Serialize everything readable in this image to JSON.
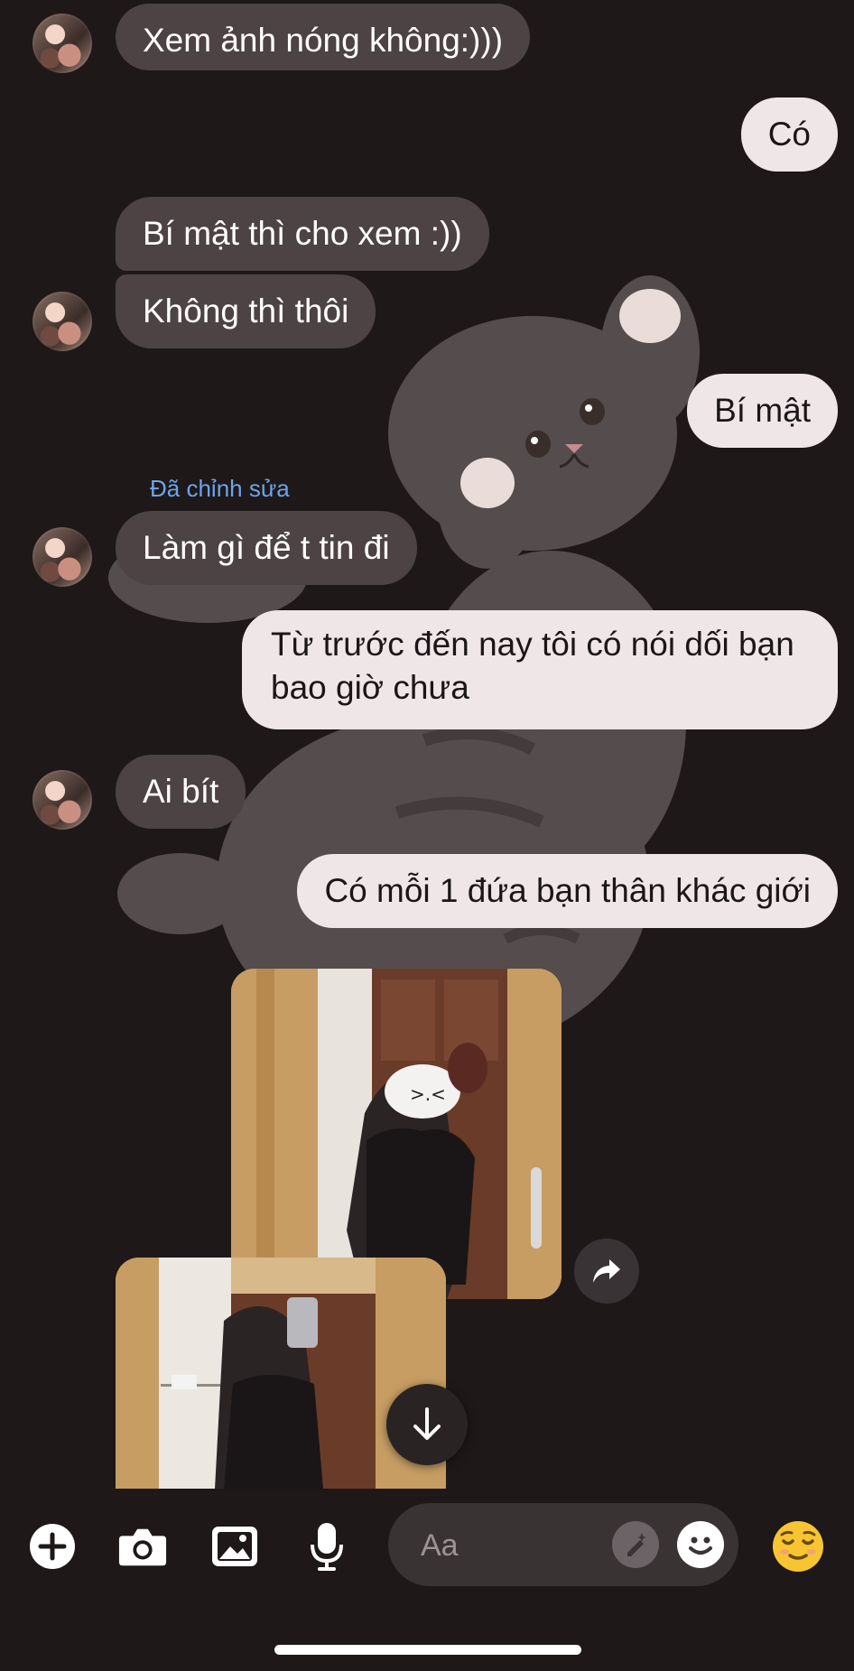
{
  "conversation": {
    "messages": [
      {
        "side": "incoming",
        "text": "Xem ảnh nóng không:)))"
      },
      {
        "side": "outgoing",
        "text": "Có"
      },
      {
        "side": "incoming",
        "text": "Bí mật thì cho xem :))"
      },
      {
        "side": "incoming",
        "text": "Không thì thôi"
      },
      {
        "side": "outgoing",
        "text": "Bí mật"
      },
      {
        "side": "incoming",
        "text": "Làm gì để t tin đi",
        "edited_label": "Đã chỉnh sửa"
      },
      {
        "side": "outgoing",
        "text": "Từ trước đến nay tôi có nói dối bạn bao giờ chưa"
      },
      {
        "side": "incoming",
        "text": "Ai bít"
      },
      {
        "side": "outgoing",
        "text": "Có mỗi 1 đứa bạn thân khác giới"
      }
    ]
  },
  "composer": {
    "placeholder": "Aa",
    "icons": [
      "plus-icon",
      "camera-icon",
      "gallery-icon",
      "microphone-icon",
      "ai-pen-icon",
      "smiley-icon",
      "relieved-emoji-icon"
    ],
    "quick_reaction": "😌"
  },
  "colors": {
    "background": "#1e1819",
    "incoming_bubble": "#4d4244",
    "outgoing_bubble": "#efe6e8",
    "edited_label": "#6da4e8"
  }
}
